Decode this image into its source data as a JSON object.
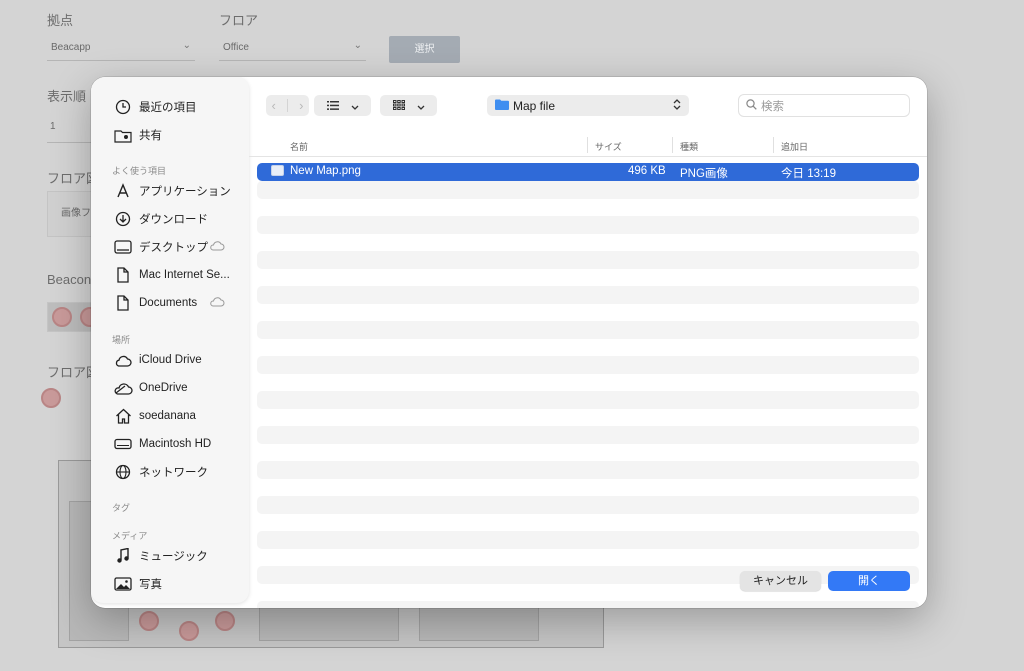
{
  "background": {
    "labels": {
      "location": "拠点",
      "floor": "フロア",
      "display_order": "表示順",
      "floor_map_1": "フロア図",
      "beacon": "Beacon",
      "floor_map_2": "フロア図"
    },
    "location_value": "Beacapp",
    "floor_value": "Office",
    "select_button": "選択",
    "display_order_value": "1",
    "image_placeholder": "画像フ"
  },
  "dialog": {
    "sidebar": {
      "favorites_header": "よく使う項目",
      "locations_header": "場所",
      "tags_header": "タグ",
      "media_header": "メディア",
      "top_items": [
        {
          "label": "最近の項目",
          "icon": "clock-icon"
        },
        {
          "label": "共有",
          "icon": "shared-folder-icon"
        }
      ],
      "favorites": [
        {
          "label": "アプリケーション",
          "icon": "applications-icon"
        },
        {
          "label": "ダウンロード",
          "icon": "download-icon"
        },
        {
          "label": "デスクトップ",
          "icon": "desktop-icon",
          "cloud": true
        },
        {
          "label": "Mac Internet Se...",
          "icon": "document-icon"
        },
        {
          "label": "Documents",
          "icon": "document-icon",
          "cloud": true
        }
      ],
      "locations": [
        {
          "label": "iCloud Drive",
          "icon": "cloud-icon"
        },
        {
          "label": "OneDrive",
          "icon": "onedrive-cloud-icon"
        },
        {
          "label": "soedanana",
          "icon": "home-icon"
        },
        {
          "label": "Macintosh HD",
          "icon": "disk-icon"
        },
        {
          "label": "ネットワーク",
          "icon": "globe-icon"
        }
      ],
      "media": [
        {
          "label": "ミュージック",
          "icon": "music-icon"
        },
        {
          "label": "写真",
          "icon": "photos-icon"
        }
      ]
    },
    "toolbar": {
      "current_folder": "Map file",
      "search_placeholder": "検索"
    },
    "columns": {
      "name": "名前",
      "size": "サイズ",
      "kind": "種類",
      "date_added": "追加日"
    },
    "files": [
      {
        "name": "New Map.png",
        "size": "496 KB",
        "kind": "PNG画像",
        "date_added": "今日 13:19",
        "selected": true
      }
    ],
    "buttons": {
      "cancel": "キャンセル",
      "open": "開く"
    },
    "colors": {
      "accent": "#3379f6",
      "selection": "#2f6ad8"
    }
  }
}
